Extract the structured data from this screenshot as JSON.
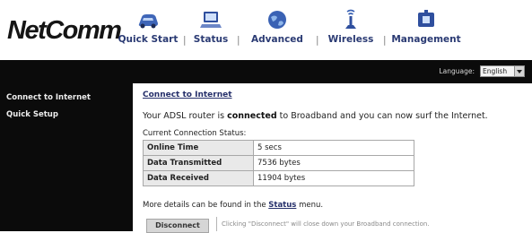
{
  "header": {
    "logo_text": "NetComm",
    "nav": [
      {
        "label": "Quick Start",
        "icon": "car-icon"
      },
      {
        "label": "Status",
        "icon": "monitor-icon"
      },
      {
        "label": "Advanced",
        "icon": "globe-icon"
      },
      {
        "label": "Wireless",
        "icon": "antenna-icon"
      },
      {
        "label": "Management",
        "icon": "toolbox-icon"
      }
    ],
    "separator": "|"
  },
  "language": {
    "label": "Language:",
    "selected": "English"
  },
  "sidebar": {
    "items": [
      {
        "label": "Connect to Internet"
      },
      {
        "label": "Quick Setup"
      }
    ]
  },
  "main": {
    "title": "Connect to Internet",
    "status_message": {
      "prefix": "Your ADSL router is ",
      "state": "connected",
      "suffix": " to Broadband and you can now surf the Internet."
    },
    "current_status_label": "Current Connection Status:",
    "table": [
      {
        "label": "Online Time",
        "value": "5 secs"
      },
      {
        "label": "Data Transmitted",
        "value": "7536 bytes"
      },
      {
        "label": "Data Received",
        "value": "11904 bytes"
      }
    ],
    "more_details": {
      "prefix": "More details can be found in the ",
      "link": "Status",
      "suffix": " menu."
    },
    "disconnect": {
      "button_label": "Disconnect",
      "help_text": "Clicking \"Disconnect\" will close down your Broadband connection."
    }
  },
  "colors": {
    "nav_text": "#2a3a73",
    "band": "#0b0b0b",
    "title_link": "#26306b",
    "table_label_bg": "#e9e9e9"
  }
}
